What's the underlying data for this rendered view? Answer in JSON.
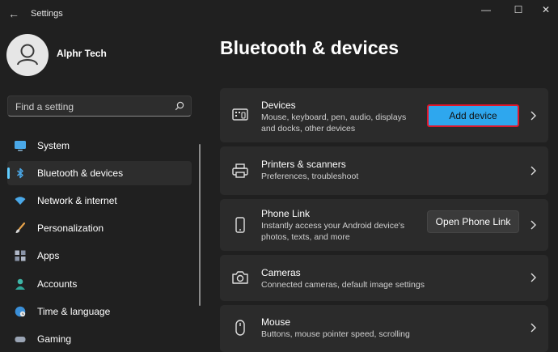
{
  "window": {
    "title": "Settings",
    "back_glyph": "←",
    "min_glyph": "—",
    "max_glyph": "☐",
    "close_glyph": "✕"
  },
  "user": {
    "name": "Alphr Tech"
  },
  "search": {
    "placeholder": "Find a setting"
  },
  "sidebar": {
    "items": [
      {
        "label": "System",
        "icon": "monitor-icon"
      },
      {
        "label": "Bluetooth & devices",
        "icon": "bluetooth-icon",
        "active": true
      },
      {
        "label": "Network & internet",
        "icon": "wifi-icon"
      },
      {
        "label": "Personalization",
        "icon": "brush-icon"
      },
      {
        "label": "Apps",
        "icon": "apps-icon"
      },
      {
        "label": "Accounts",
        "icon": "person-icon"
      },
      {
        "label": "Time & language",
        "icon": "globe-clock-icon"
      },
      {
        "label": "Gaming",
        "icon": "gamepad-icon"
      }
    ]
  },
  "main": {
    "title": "Bluetooth & devices",
    "cards": [
      {
        "title": "Devices",
        "subtitle": "Mouse, keyboard, pen, audio, displays and docks, other devices",
        "button": "Add device",
        "icon": "devices-icon"
      },
      {
        "title": "Printers & scanners",
        "subtitle": "Preferences, troubleshoot",
        "icon": "printer-icon"
      },
      {
        "title": "Phone Link",
        "subtitle": "Instantly access your Android device's photos, texts, and more",
        "button": "Open Phone Link",
        "icon": "phone-icon"
      },
      {
        "title": "Cameras",
        "subtitle": "Connected cameras, default image settings",
        "icon": "camera-icon"
      },
      {
        "title": "Mouse",
        "subtitle": "Buttons, mouse pointer speed, scrolling",
        "icon": "mouse-icon"
      }
    ]
  },
  "colors": {
    "background": "#202020",
    "card": "#2b2b2b",
    "accent": "#60cdff",
    "highlight_border": "#e0162b",
    "add_button": "#2ea7ee"
  }
}
